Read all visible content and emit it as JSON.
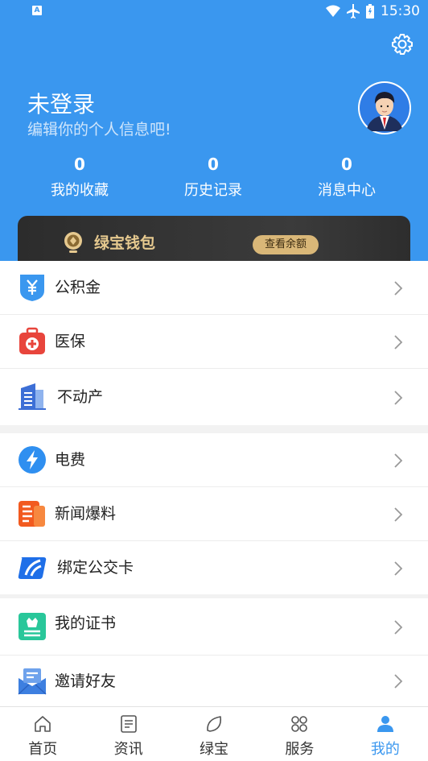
{
  "status_bar": {
    "time": "15:30",
    "notification_icon": "A"
  },
  "header": {
    "settings_icon": "gear-icon",
    "user_name": "未登录",
    "user_subtitle": "编辑你的个人信息吧!",
    "stats": [
      {
        "count": "0",
        "label": "我的收藏"
      },
      {
        "count": "0",
        "label": "历史记录"
      },
      {
        "count": "0",
        "label": "消息中心"
      }
    ]
  },
  "wallet": {
    "title": "绿宝钱包",
    "button_label": "查看余额"
  },
  "menu_groups": [
    {
      "items": [
        {
          "label": "公积金",
          "icon": "housing-fund-icon",
          "color": "#3a97ef"
        },
        {
          "label": "医保",
          "icon": "medical-kit-icon",
          "color": "#e8453c"
        },
        {
          "label": "不动产",
          "icon": "building-icon",
          "color": "#3d6fd6"
        }
      ]
    },
    {
      "items": [
        {
          "label": "电费",
          "icon": "lightning-icon",
          "color": "#2f8ff0"
        },
        {
          "label": "新闻爆料",
          "icon": "news-icon",
          "color": "#f25a1f"
        },
        {
          "label": "绑定公交卡",
          "icon": "bus-card-icon",
          "color": "#1f6fe8"
        }
      ]
    },
    {
      "items": [
        {
          "label": "我的证书",
          "icon": "certificate-icon",
          "color": "#29c79a"
        },
        {
          "label": "邀请好友",
          "icon": "invite-mail-icon",
          "color": "#3d7fe0"
        }
      ]
    }
  ],
  "tab_bar": [
    {
      "label": "首页",
      "icon": "home-icon",
      "active": false
    },
    {
      "label": "资讯",
      "icon": "news-list-icon",
      "active": false
    },
    {
      "label": "绿宝",
      "icon": "leaf-icon",
      "active": false
    },
    {
      "label": "服务",
      "icon": "services-grid-icon",
      "active": false
    },
    {
      "label": "我的",
      "icon": "user-icon",
      "active": true
    }
  ],
  "colors": {
    "primary": "#3a97ef",
    "wallet_gold": "#d9b778"
  }
}
